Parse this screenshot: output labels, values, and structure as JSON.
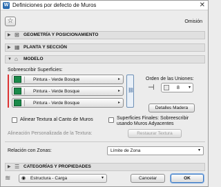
{
  "window": {
    "title": "Definiciones por defecto de Muros",
    "close_glyph": "✕",
    "app_icon": "W"
  },
  "toolbar": {
    "favorites_icon": "star-icon",
    "omission_label": "Omisión"
  },
  "sections": {
    "geometry": "GEOMETRÍA Y POSICIONAMIENTO",
    "floorplan": "PLANTA Y SECCIÓN",
    "model": "MODELO",
    "categories": "CATEGORÍAS Y PROPIEDADES"
  },
  "model": {
    "override_surfaces_label": "Sobreescribir Superficies:",
    "surfaces": [
      {
        "name": "Pintura - Verde Bosque",
        "color": "#1a8a4a"
      },
      {
        "name": "Pintura - Verde Bosque",
        "color": "#1a8a4a"
      },
      {
        "name": "Pintura - Verde Bosque",
        "color": "#1a8a4a"
      }
    ],
    "join_order_label": "Orden de las Uniones:",
    "join_order_value": "8",
    "wood_details_button": "Detalles Madera",
    "align_texture_label": "Alinear Textura al Canto de Muros",
    "final_surfaces_label_1": "Superficies Finales: Sobreescribir",
    "final_surfaces_label_2": "usando Muros Adyacentes",
    "custom_align_label": "Alineación Personalizada de la Textura:",
    "reset_texture_button": "Restaurar Textura",
    "zone_relation_label": "Relación con Zonas:",
    "zone_relation_value": "Límite de Zona"
  },
  "footer": {
    "layer_value": "Estructura - Carga",
    "cancel_button": "Cancelar",
    "ok_button": "OK"
  }
}
